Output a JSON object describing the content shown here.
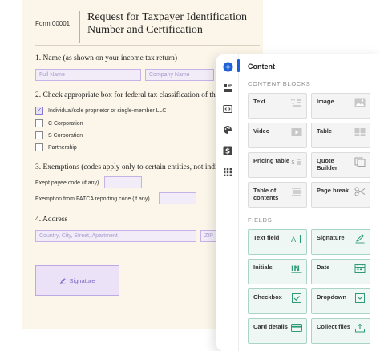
{
  "form": {
    "number": "Form 00001",
    "title": "Request for Taxpayer Identification Number and Certification",
    "section1": "1. Name (as shown on your income tax return)",
    "full_name_placeholder": "Full Name",
    "company_name_placeholder": "Company Name",
    "section2": "2. Check appropriate box for federal tax classification of the",
    "checkboxes": [
      {
        "label": "Individual/sole proprietor or single-member LLC",
        "checked": true
      },
      {
        "label": "C Corporation",
        "checked": false
      },
      {
        "label": "S Corporation",
        "checked": false
      },
      {
        "label": "Partnership",
        "checked": false
      }
    ],
    "section3": "3. Exemptions (codes apply only to certain entities, not indiv",
    "exempt_payee_label": "Exept payee code (if any)",
    "fatca_label": "Exemption from FATCA reporting code (if any)",
    "section4": "4. Address",
    "address_placeholder": "Country, City, Street, Apartment",
    "zip_placeholder": "ZIP",
    "signature_label": "Signature"
  },
  "panel": {
    "title": "Content",
    "content_blocks_heading": "CONTENT BLOCKS",
    "fields_heading": "FIELDS",
    "content_blocks": [
      {
        "label": "Text",
        "icon": "text-icon"
      },
      {
        "label": "Image",
        "icon": "image-icon"
      },
      {
        "label": "Video",
        "icon": "video-icon"
      },
      {
        "label": "Table",
        "icon": "table-icon"
      },
      {
        "label": "Pricing table",
        "icon": "pricing-table-icon"
      },
      {
        "label": "Quote Builder",
        "icon": "quote-builder-icon"
      },
      {
        "label": "Table of contents",
        "icon": "toc-icon"
      },
      {
        "label": "Page break",
        "icon": "scissors-icon"
      }
    ],
    "fields": [
      {
        "label": "Text field",
        "icon": "text-field-icon"
      },
      {
        "label": "Signature",
        "icon": "pen-icon"
      },
      {
        "label": "Initials",
        "icon": "initials-icon"
      },
      {
        "label": "Date",
        "icon": "calendar-icon"
      },
      {
        "label": "Checkbox",
        "icon": "checkbox-icon"
      },
      {
        "label": "Dropdown",
        "icon": "dropdown-icon"
      },
      {
        "label": "Card details",
        "icon": "card-icon"
      },
      {
        "label": "Collect files",
        "icon": "upload-icon"
      }
    ]
  },
  "colors": {
    "accent": "#1e60d6",
    "field_green": "#2e9b76",
    "form_field_purple": "#c4b2e8"
  }
}
